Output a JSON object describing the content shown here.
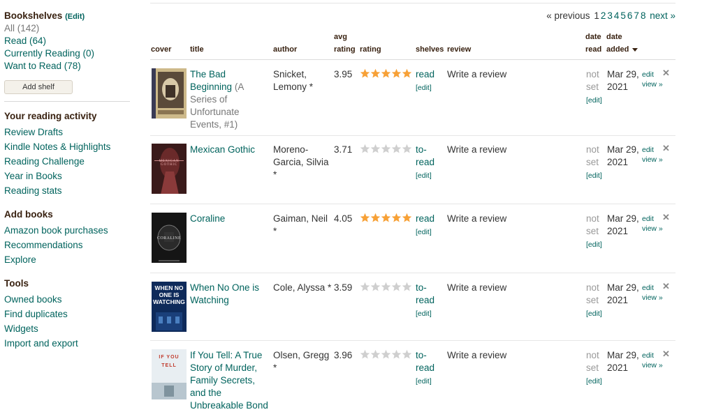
{
  "sidebar": {
    "bookshelves_heading": "Bookshelves",
    "bookshelves_edit": "(Edit)",
    "shelves": [
      {
        "label": "All (142)"
      },
      {
        "label": "Read (64)"
      },
      {
        "label": "Currently Reading (0)"
      },
      {
        "label": "Want to Read (78)"
      }
    ],
    "add_shelf_label": "Add shelf",
    "activity_heading": "Your reading activity",
    "activity_links": [
      "Review Drafts",
      "Kindle Notes & Highlights",
      "Reading Challenge",
      "Year in Books",
      "Reading stats"
    ],
    "add_books_heading": "Add books",
    "add_books_links": [
      "Amazon book purchases",
      "Recommendations",
      "Explore"
    ],
    "tools_heading": "Tools",
    "tools_links": [
      "Owned books",
      "Find duplicates",
      "Widgets",
      "Import and export"
    ]
  },
  "pagination": {
    "previous": "« previous",
    "pages": [
      "1",
      "2",
      "3",
      "4",
      "5",
      "6",
      "7",
      "8"
    ],
    "current": "1",
    "next": "next »"
  },
  "table": {
    "headers": {
      "cover": "cover",
      "title": "title",
      "author": "author",
      "avg_top": "avg",
      "avg_bottom": "rating",
      "rating": "rating",
      "shelves": "shelves",
      "review": "review",
      "date_read_top": "date",
      "date_read_bottom": "read",
      "date_added_top": "date",
      "date_added_bottom": "added"
    },
    "rows": [
      {
        "title": "The Bad Beginning",
        "series": "(A Series of Unfortunate Events, #1)",
        "author": "Snicket, Lemony *",
        "avg_rating": "3.95",
        "rating": 5,
        "shelf": "read",
        "shelf_edit": "[edit]",
        "review": "Write a review",
        "date_read": "not set",
        "date_read_edit": "[edit]",
        "date_added": "Mar 29, 2021",
        "edit": "edit",
        "view": "view »"
      },
      {
        "title": "Mexican Gothic",
        "series": "",
        "author": "Moreno-Garcia, Silvia *",
        "avg_rating": "3.71",
        "rating": 0,
        "shelf": "to-read",
        "shelf_edit": "[edit]",
        "review": "Write a review",
        "date_read": "not set",
        "date_read_edit": "[edit]",
        "date_added": "Mar 29, 2021",
        "edit": "edit",
        "view": "view »"
      },
      {
        "title": "Coraline",
        "series": "",
        "author": "Gaiman, Neil *",
        "avg_rating": "4.05",
        "rating": 5,
        "shelf": "read",
        "shelf_edit": "[edit]",
        "review": "Write a review",
        "date_read": "not set",
        "date_read_edit": "[edit]",
        "date_added": "Mar 29, 2021",
        "edit": "edit",
        "view": "view »"
      },
      {
        "title": "When No One is Watching",
        "series": "",
        "author": "Cole, Alyssa *",
        "avg_rating": "3.59",
        "rating": 0,
        "shelf": "to-read",
        "shelf_edit": "[edit]",
        "review": "Write a review",
        "date_read": "not set",
        "date_read_edit": "[edit]",
        "date_added": "Mar 29, 2021",
        "edit": "edit",
        "view": "view »"
      },
      {
        "title": "If You Tell: A True Story of Murder, Family Secrets, and the Unbreakable Bond",
        "series": "",
        "author": "Olsen, Gregg *",
        "avg_rating": "3.96",
        "rating": 0,
        "shelf": "to-read",
        "shelf_edit": "[edit]",
        "review": "Write a review",
        "date_read": "not set",
        "date_read_edit": "[edit]",
        "date_added": "Mar 29, 2021",
        "edit": "edit",
        "view": "view »"
      }
    ]
  },
  "covers": [
    {
      "text": "",
      "icon": "book-cover-bad-beginning"
    },
    {
      "text": "MEXICAN GOTHIC",
      "icon": "book-cover-mexican-gothic"
    },
    {
      "text": "CORALINE",
      "icon": "book-cover-coraline"
    },
    {
      "text": "WHEN NO ONE IS WATCHING",
      "icon": "book-cover-when-no-one-watching"
    },
    {
      "text": "IF YOU TELL",
      "icon": "book-cover-if-you-tell"
    }
  ],
  "colors": {
    "link": "#00635d",
    "star_filled": "#f7a137",
    "star_empty": "#cfcfcf",
    "heading": "#382110"
  }
}
